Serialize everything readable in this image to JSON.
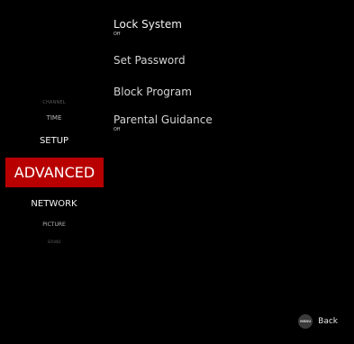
{
  "menu": {
    "items": [
      {
        "label": "CHANNEL"
      },
      {
        "label": "TIME"
      },
      {
        "label": "SETUP"
      },
      {
        "label": "ADVANCED"
      },
      {
        "label": "NETWORK"
      },
      {
        "label": "PICTURE"
      },
      {
        "label": "SOUND"
      }
    ],
    "selected": "ADVANCED",
    "accent_color": "#b80000"
  },
  "options": [
    {
      "title": "Lock System",
      "value": "Off"
    },
    {
      "title": "Set Password"
    },
    {
      "title": "Block Program"
    },
    {
      "title": "Parental Guidance",
      "value": "Off"
    }
  ],
  "footer": {
    "key_label": "MENU",
    "back_label": "Back"
  }
}
